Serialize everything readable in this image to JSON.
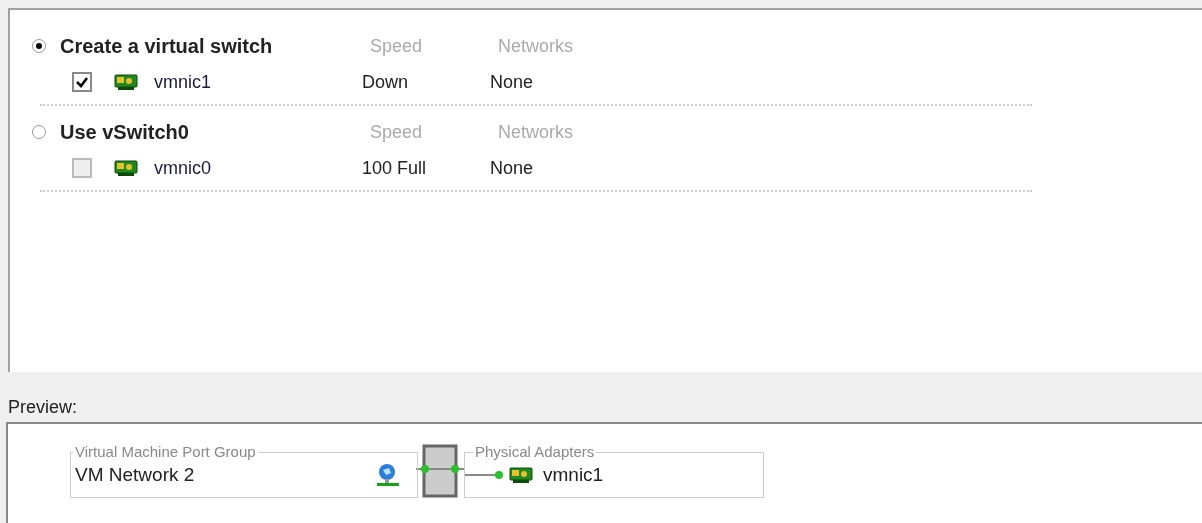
{
  "options": [
    {
      "label": "Create a virtual switch",
      "selected": true,
      "speed_header": "Speed",
      "networks_header": "Networks",
      "adapters": [
        {
          "name": "vmnic1",
          "checked": true,
          "disabled": false,
          "speed": "Down",
          "networks": "None"
        }
      ]
    },
    {
      "label": "Use vSwitch0",
      "selected": false,
      "speed_header": "Speed",
      "networks_header": "Networks",
      "adapters": [
        {
          "name": "vmnic0",
          "checked": false,
          "disabled": true,
          "speed": "100 Full",
          "networks": "None"
        }
      ]
    }
  ],
  "preview": {
    "label": "Preview:",
    "port_group": {
      "title": "Virtual Machine Port Group",
      "name": "VM Network 2"
    },
    "physical_adapters": {
      "title": "Physical Adapters",
      "adapters": [
        "vmnic1"
      ]
    }
  }
}
